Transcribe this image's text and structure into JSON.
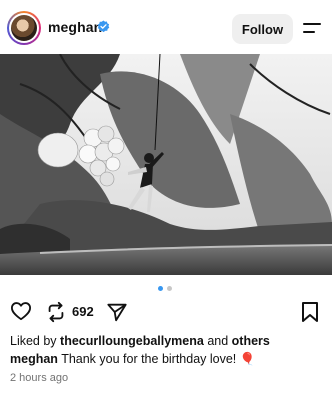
{
  "post": {
    "username": "meghan",
    "follow_label": "Follow",
    "repost_count": "692",
    "liked_by_prefix": "Liked by",
    "liked_by_user": "thecurllounge​ballymena",
    "liked_by_and": "and",
    "liked_by_others": "others",
    "caption_user": "meghan",
    "caption_text": "Thank you for the birthday love!",
    "caption_emoji": "🎈",
    "timestamp": "2 hours ago"
  },
  "carousel": {
    "current": 1,
    "total": 2
  },
  "icons": {
    "verified": "verified-badge-icon",
    "menu": "menu-icon",
    "like": "heart-icon",
    "comment": "comment-icon",
    "repost": "repost-icon",
    "share": "send-icon",
    "save": "bookmark-icon"
  },
  "colors": {
    "verified": "#3897f0",
    "active_dot": "#3897f0",
    "follow_bg": "#efefef"
  }
}
